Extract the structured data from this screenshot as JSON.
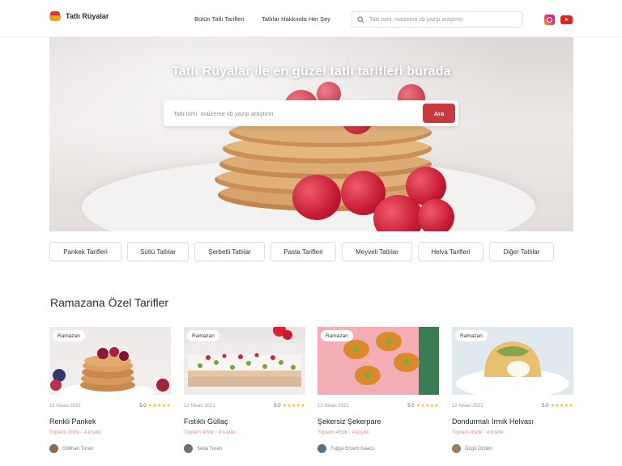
{
  "header": {
    "brand": "Tatlı Rüyalar",
    "nav": [
      "Bütün Tatlı Tarifleri",
      "Tatlılar Hakkında Her Şey"
    ],
    "search_placeholder": "Tatlı ismi, malzeme vb yazıp araştırın"
  },
  "hero": {
    "title": "Tatlı Rüyalar ile en güzel tatlı tarifleri burada",
    "search_placeholder": "Tatlı ismi, malzeme vb yazıp araştırın",
    "search_button": "Ara"
  },
  "categories": [
    "Pankek Tarifleri",
    "Sütlü Tatlılar",
    "Şerbetli Tatlılar",
    "Pasta Tarifleri",
    "Meyveli Tatlılar",
    "Helva Tarifleri",
    "Diğer Tatlılar"
  ],
  "section": {
    "title": "Ramazana Özel Tarifler"
  },
  "cards": [
    {
      "tag": "Ramazan",
      "date": "12 Nisan 2021",
      "rating": "5.0",
      "stars": "★★★★★",
      "title": "Renkli Pankek",
      "subtitle": "Toplam 30dk · 4 kişilik",
      "author": "Gökhan Turan"
    },
    {
      "tag": "Ramazan",
      "date": "12 Nisan 2021",
      "rating": "5.0",
      "stars": "★★★★★",
      "title": "Fıstıklı Güllaç",
      "subtitle": "Toplam 40dk · 4 kişilik",
      "author": "Seda Turan"
    },
    {
      "tag": "Ramazan",
      "date": "12 Nisan 2021",
      "rating": "5.0",
      "stars": "★★★★★",
      "title": "Şekersiz Şekerpare",
      "subtitle": "Toplam 45dk · 4 kişilik",
      "author": "Tuğçe Ercem Isaacs"
    },
    {
      "tag": "Ramazan",
      "date": "12 Nisan 2021",
      "rating": "5.0",
      "stars": "★★★★★",
      "title": "Dondurmalı İrmik Helvası",
      "subtitle": "Toplam 45dk · 4 kişilik",
      "author": "Özgü Özden"
    }
  ],
  "icons": {
    "logo": "dessert-logo-icon",
    "search": "search-icon",
    "instagram": "instagram-icon",
    "youtube": "youtube-icon"
  },
  "colors": {
    "accent": "#c8393f",
    "subtitle": "#f08a8a",
    "star": "#f2b531"
  }
}
